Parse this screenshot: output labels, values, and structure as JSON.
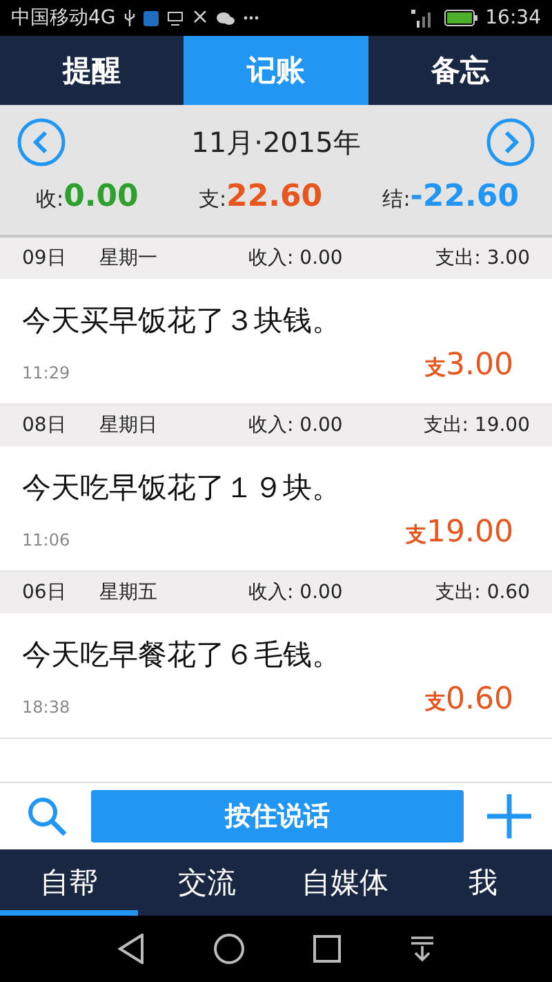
{
  "status_bar": {
    "carrier": "中国移动4G",
    "time": "16:34"
  },
  "tabs": [
    {
      "label": "提醒",
      "selected": false
    },
    {
      "label": "记账",
      "selected": true
    },
    {
      "label": "备忘",
      "selected": false
    }
  ],
  "month": {
    "title": "11月·2015年"
  },
  "totals": [
    {
      "label": "收:",
      "value": "0.00",
      "color": "#2ea02e"
    },
    {
      "label": "支:",
      "value": "22.60",
      "color": "#e8561f"
    },
    {
      "label": "结:",
      "value": "-22.60",
      "color": "#2196f3"
    }
  ],
  "days": [
    {
      "date": "09日",
      "weekday": "星期一",
      "income": "收入:  0.00",
      "expense": "支出:  3.00",
      "entries": [
        {
          "text": "今天买早饭花了３块钱。",
          "time": "11:29",
          "prefix": "支",
          "amount": "3.00"
        }
      ]
    },
    {
      "date": "08日",
      "weekday": "星期日",
      "income": "收入:  0.00",
      "expense": "支出:  19.00",
      "entries": [
        {
          "text": "今天吃早饭花了１９块。",
          "time": "11:06",
          "prefix": "支",
          "amount": "19.00"
        }
      ]
    },
    {
      "date": "06日",
      "weekday": "星期五",
      "income": "收入:  0.00",
      "expense": "支出:  0.60",
      "entries": [
        {
          "text": "今天吃早餐花了６毛钱。",
          "time": "18:38",
          "prefix": "支",
          "amount": "0.60"
        }
      ]
    }
  ],
  "voice_button": "按住说话",
  "bottom_tabs": [
    {
      "label": "自帮",
      "selected": true
    },
    {
      "label": "交流",
      "selected": false
    },
    {
      "label": "自媒体",
      "selected": false
    },
    {
      "label": "我",
      "selected": false
    }
  ]
}
